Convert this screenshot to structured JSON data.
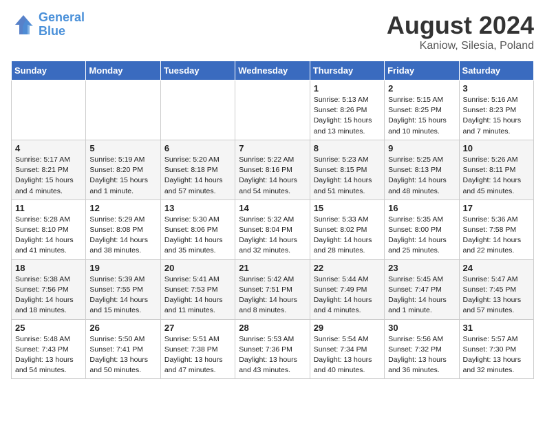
{
  "header": {
    "logo_line1": "General",
    "logo_line2": "Blue",
    "month": "August 2024",
    "location": "Kaniow, Silesia, Poland"
  },
  "days_of_week": [
    "Sunday",
    "Monday",
    "Tuesday",
    "Wednesday",
    "Thursday",
    "Friday",
    "Saturday"
  ],
  "weeks": [
    [
      {
        "day": "",
        "info": ""
      },
      {
        "day": "",
        "info": ""
      },
      {
        "day": "",
        "info": ""
      },
      {
        "day": "",
        "info": ""
      },
      {
        "day": "1",
        "info": "Sunrise: 5:13 AM\nSunset: 8:26 PM\nDaylight: 15 hours\nand 13 minutes."
      },
      {
        "day": "2",
        "info": "Sunrise: 5:15 AM\nSunset: 8:25 PM\nDaylight: 15 hours\nand 10 minutes."
      },
      {
        "day": "3",
        "info": "Sunrise: 5:16 AM\nSunset: 8:23 PM\nDaylight: 15 hours\nand 7 minutes."
      }
    ],
    [
      {
        "day": "4",
        "info": "Sunrise: 5:17 AM\nSunset: 8:21 PM\nDaylight: 15 hours\nand 4 minutes."
      },
      {
        "day": "5",
        "info": "Sunrise: 5:19 AM\nSunset: 8:20 PM\nDaylight: 15 hours\nand 1 minute."
      },
      {
        "day": "6",
        "info": "Sunrise: 5:20 AM\nSunset: 8:18 PM\nDaylight: 14 hours\nand 57 minutes."
      },
      {
        "day": "7",
        "info": "Sunrise: 5:22 AM\nSunset: 8:16 PM\nDaylight: 14 hours\nand 54 minutes."
      },
      {
        "day": "8",
        "info": "Sunrise: 5:23 AM\nSunset: 8:15 PM\nDaylight: 14 hours\nand 51 minutes."
      },
      {
        "day": "9",
        "info": "Sunrise: 5:25 AM\nSunset: 8:13 PM\nDaylight: 14 hours\nand 48 minutes."
      },
      {
        "day": "10",
        "info": "Sunrise: 5:26 AM\nSunset: 8:11 PM\nDaylight: 14 hours\nand 45 minutes."
      }
    ],
    [
      {
        "day": "11",
        "info": "Sunrise: 5:28 AM\nSunset: 8:10 PM\nDaylight: 14 hours\nand 41 minutes."
      },
      {
        "day": "12",
        "info": "Sunrise: 5:29 AM\nSunset: 8:08 PM\nDaylight: 14 hours\nand 38 minutes."
      },
      {
        "day": "13",
        "info": "Sunrise: 5:30 AM\nSunset: 8:06 PM\nDaylight: 14 hours\nand 35 minutes."
      },
      {
        "day": "14",
        "info": "Sunrise: 5:32 AM\nSunset: 8:04 PM\nDaylight: 14 hours\nand 32 minutes."
      },
      {
        "day": "15",
        "info": "Sunrise: 5:33 AM\nSunset: 8:02 PM\nDaylight: 14 hours\nand 28 minutes."
      },
      {
        "day": "16",
        "info": "Sunrise: 5:35 AM\nSunset: 8:00 PM\nDaylight: 14 hours\nand 25 minutes."
      },
      {
        "day": "17",
        "info": "Sunrise: 5:36 AM\nSunset: 7:58 PM\nDaylight: 14 hours\nand 22 minutes."
      }
    ],
    [
      {
        "day": "18",
        "info": "Sunrise: 5:38 AM\nSunset: 7:56 PM\nDaylight: 14 hours\nand 18 minutes."
      },
      {
        "day": "19",
        "info": "Sunrise: 5:39 AM\nSunset: 7:55 PM\nDaylight: 14 hours\nand 15 minutes."
      },
      {
        "day": "20",
        "info": "Sunrise: 5:41 AM\nSunset: 7:53 PM\nDaylight: 14 hours\nand 11 minutes."
      },
      {
        "day": "21",
        "info": "Sunrise: 5:42 AM\nSunset: 7:51 PM\nDaylight: 14 hours\nand 8 minutes."
      },
      {
        "day": "22",
        "info": "Sunrise: 5:44 AM\nSunset: 7:49 PM\nDaylight: 14 hours\nand 4 minutes."
      },
      {
        "day": "23",
        "info": "Sunrise: 5:45 AM\nSunset: 7:47 PM\nDaylight: 14 hours\nand 1 minute."
      },
      {
        "day": "24",
        "info": "Sunrise: 5:47 AM\nSunset: 7:45 PM\nDaylight: 13 hours\nand 57 minutes."
      }
    ],
    [
      {
        "day": "25",
        "info": "Sunrise: 5:48 AM\nSunset: 7:43 PM\nDaylight: 13 hours\nand 54 minutes."
      },
      {
        "day": "26",
        "info": "Sunrise: 5:50 AM\nSunset: 7:41 PM\nDaylight: 13 hours\nand 50 minutes."
      },
      {
        "day": "27",
        "info": "Sunrise: 5:51 AM\nSunset: 7:38 PM\nDaylight: 13 hours\nand 47 minutes."
      },
      {
        "day": "28",
        "info": "Sunrise: 5:53 AM\nSunset: 7:36 PM\nDaylight: 13 hours\nand 43 minutes."
      },
      {
        "day": "29",
        "info": "Sunrise: 5:54 AM\nSunset: 7:34 PM\nDaylight: 13 hours\nand 40 minutes."
      },
      {
        "day": "30",
        "info": "Sunrise: 5:56 AM\nSunset: 7:32 PM\nDaylight: 13 hours\nand 36 minutes."
      },
      {
        "day": "31",
        "info": "Sunrise: 5:57 AM\nSunset: 7:30 PM\nDaylight: 13 hours\nand 32 minutes."
      }
    ]
  ]
}
